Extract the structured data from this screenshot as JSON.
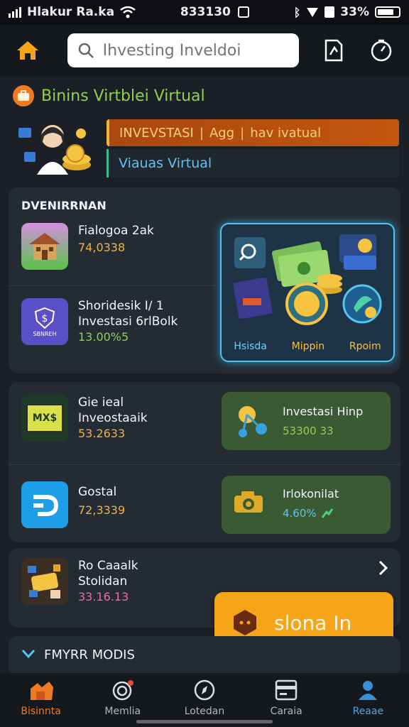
{
  "status_bar": {
    "carrier": "Hlakur Ra.ka",
    "time": "833130",
    "battery": "33%"
  },
  "header": {
    "search_placeholder": "Ihvesting Inveldoi"
  },
  "section": {
    "title": "Binins Virtblei Virtual"
  },
  "hero": {
    "banner_top_a": "INVEVSTASI",
    "banner_top_b": "Agg",
    "banner_top_c": "hav ivatual",
    "banner_bottom": "Viauas Virtual"
  },
  "portfolio": {
    "heading": "DVENIRRNAN",
    "items": [
      {
        "title": "Fialogoa 2ak",
        "value": "74,0338",
        "value_color": "#f3b23b"
      },
      {
        "title": "Shoridesik I/ 1",
        "subtitle": "Investasi 6rlBolk",
        "value": "13.00%5",
        "value_color": "#8fd14f",
        "thumb_label": "SBNREH"
      }
    ],
    "feature_labels": [
      "Hsisda",
      "Mippin",
      "Rpoim"
    ]
  },
  "assets": {
    "items": [
      {
        "title": "Gie ieal",
        "subtitle": "Inveostaaik",
        "value": "53.2633",
        "value_color": "#f3b23b",
        "thumb_label": "MX$"
      },
      {
        "title": "Gostal",
        "value": "72,3339",
        "value_color": "#f3b23b"
      }
    ],
    "tiles": [
      {
        "title": "Investasi Hinp",
        "value": "53300 33",
        "value_color": "#8fd14f"
      },
      {
        "title": "Irlokonilat",
        "value": "4.60%",
        "value_color": "#5fc4f0"
      }
    ]
  },
  "promo": {
    "title": "Ro Caaalk",
    "subtitle": "Stolidan",
    "value": "33.16.13",
    "value_color": "#f06aa8"
  },
  "sign_in": {
    "label": "slona In"
  },
  "collapsed_section": {
    "title": "FMYRR MODIS"
  },
  "tabs": [
    {
      "label": "Bisinnta",
      "icon": "home-icon"
    },
    {
      "label": "Memlia",
      "icon": "camera-icon"
    },
    {
      "label": "Lotedan",
      "icon": "compass-icon"
    },
    {
      "label": "Caraia",
      "icon": "card-icon"
    },
    {
      "label": "Reaae",
      "icon": "profile-icon"
    }
  ],
  "colors": {
    "accent_orange": "#f07a23",
    "accent_green": "#8fd14f",
    "accent_cyan": "#4fc7ef",
    "sign_in_button": "#f6a418",
    "background": "#1b2027"
  }
}
